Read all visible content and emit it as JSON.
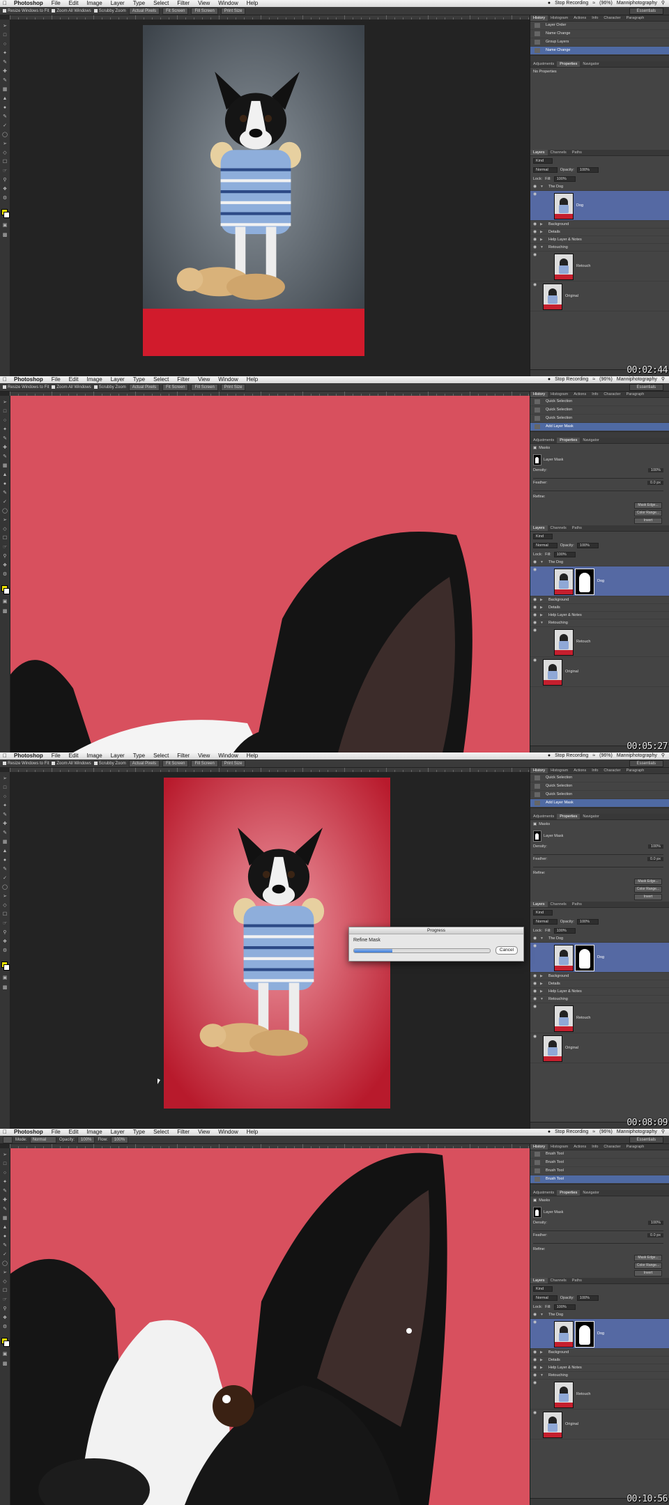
{
  "app": {
    "menu": [
      "Photoshop",
      "File",
      "Edit",
      "Image",
      "Layer",
      "Type",
      "Select",
      "Filter",
      "View",
      "Window",
      "Help"
    ],
    "status_recording": "Stop Recording",
    "battery": "(96%)",
    "user": "Manniphotography",
    "workspace": "Essentials"
  },
  "options_bar": {
    "resize_windows": "Resize Windows to Fit",
    "zoom_all": "Zoom All Windows",
    "scrubby_zoom": "Scrubby Zoom",
    "actual_pixels": "Actual Pixels",
    "fit_screen": "Fit Screen",
    "fill_screen": "Fill Screen",
    "print_size": "Print Size"
  },
  "brush_options": {
    "mode_label": "Mode:",
    "mode_value": "Normal",
    "opacity_label": "Opacity:",
    "opacity_value": "100%",
    "flow_label": "Flow:",
    "flow_value": "100%"
  },
  "panel_tabs": {
    "top": [
      "History",
      "Histogram",
      "Actions",
      "Info",
      "Character",
      "Paragraph"
    ],
    "mid": [
      "Adjustments",
      "Properties",
      "Navigator"
    ],
    "layers": [
      "Layers",
      "Channels",
      "Paths"
    ]
  },
  "properties": {
    "none": "No Properties",
    "masks": "Masks",
    "layer_mask": "Layer Mask",
    "density_label": "Density:",
    "density_value": "100%",
    "feather_label": "Feather:",
    "feather_value": "0.0 px",
    "refine_label": "Refine:",
    "mask_edge": "Mask Edge...",
    "color_range": "Color Range...",
    "invert": "Invert"
  },
  "layers_panel": {
    "kind": "Kind",
    "blend": "Normal",
    "opacity_label": "Opacity:",
    "opacity_value": "100%",
    "lock_label": "Lock:",
    "fill_label": "Fill:",
    "fill_value": "100%",
    "group_name": "The Dog",
    "layer_dog": "Dog",
    "background": "Background",
    "details": "Details",
    "help_layer": "Help Layer & Notes",
    "retouching": "Retouching",
    "retouch": "Retouch",
    "original": "Original"
  },
  "frames": [
    {
      "timecode": "00:02:44",
      "history": [
        "Layer Order",
        "Name Change",
        "Group Layers",
        "Name Change"
      ],
      "history_selected": 3
    },
    {
      "timecode": "00:05:27",
      "history": [
        "Quick Selection",
        "Quick Selection",
        "Quick Selection",
        "Add Layer Mask"
      ],
      "history_selected": 3
    },
    {
      "timecode": "00:08:09",
      "history": [
        "Quick Selection",
        "Quick Selection",
        "Quick Selection",
        "Add Layer Mask"
      ],
      "history_selected": 3,
      "dialog": {
        "title": "Progress",
        "label": "Refine Mask",
        "progress": 0.28,
        "cancel": "Cancel"
      }
    },
    {
      "timecode": "00:10:56",
      "history": [
        "Brush Tool",
        "Brush Tool",
        "Brush Tool",
        "Brush Tool"
      ],
      "history_selected": 3
    }
  ],
  "colors": {
    "backdrop_red": "#d8505e",
    "backdrop_gray": "#5c6670",
    "selection_blue": "#5569a3",
    "foreground_yellow": "#f0e400"
  }
}
